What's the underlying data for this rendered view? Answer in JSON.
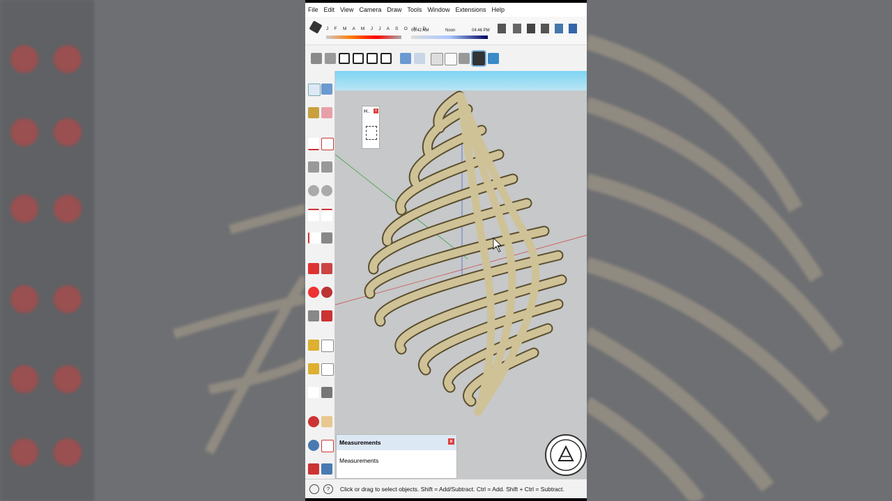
{
  "menu": [
    "File",
    "Edit",
    "View",
    "Camera",
    "Draw",
    "Tools",
    "Window",
    "Extensions",
    "Help"
  ],
  "shadow": {
    "months": "J F M A M J J A S O N D",
    "time_start": "06:42 AM",
    "time_mid": "Noon",
    "time_end": "04:46 PM"
  },
  "panel_small": {
    "label": "H..",
    "close": "x"
  },
  "measurements": {
    "title": "Measurements",
    "body": "Measurements",
    "close": "x"
  },
  "status": {
    "message": "Click or drag to select objects. Shift = Add/Subtract. Ctrl = Add. Shift + Ctrl = Subtract."
  },
  "colors": {
    "accent_sky": "#7ed4f4",
    "model": "#cfc296",
    "viewport_bg": "#c6c8c9"
  }
}
